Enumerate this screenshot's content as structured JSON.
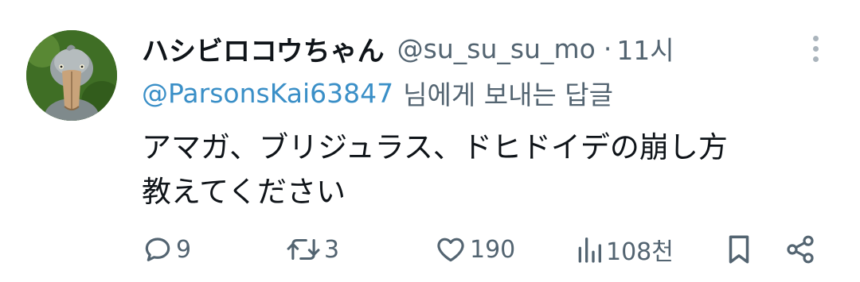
{
  "tweet": {
    "display_name": "ハシビロコウちゃん",
    "handle": "@su_su_su_mo",
    "separator": "·",
    "time": "11시",
    "reply_to": {
      "mention": "@ParsonsKai63847",
      "suffix": "님에게 보내는 답글"
    },
    "text_lines": [
      "アマガ、ブリジュラス、ドヒドイデの崩し方",
      "教えてください"
    ]
  },
  "actions": {
    "replies": "9",
    "reposts": "3",
    "likes": "190",
    "views": "108천"
  },
  "icons": {
    "avatar": "shoebill-bird-avatar",
    "more": "more-vertical-icon",
    "reply": "reply-bubble-icon",
    "repost": "repost-icon",
    "like": "heart-icon",
    "views": "analytics-bars-icon",
    "bookmark": "bookmark-icon",
    "share": "share-icon"
  },
  "colors": {
    "text": "#0f1419",
    "secondary": "#536471",
    "mention": "#3a8fc7",
    "more_dots": "#aab4bc"
  }
}
